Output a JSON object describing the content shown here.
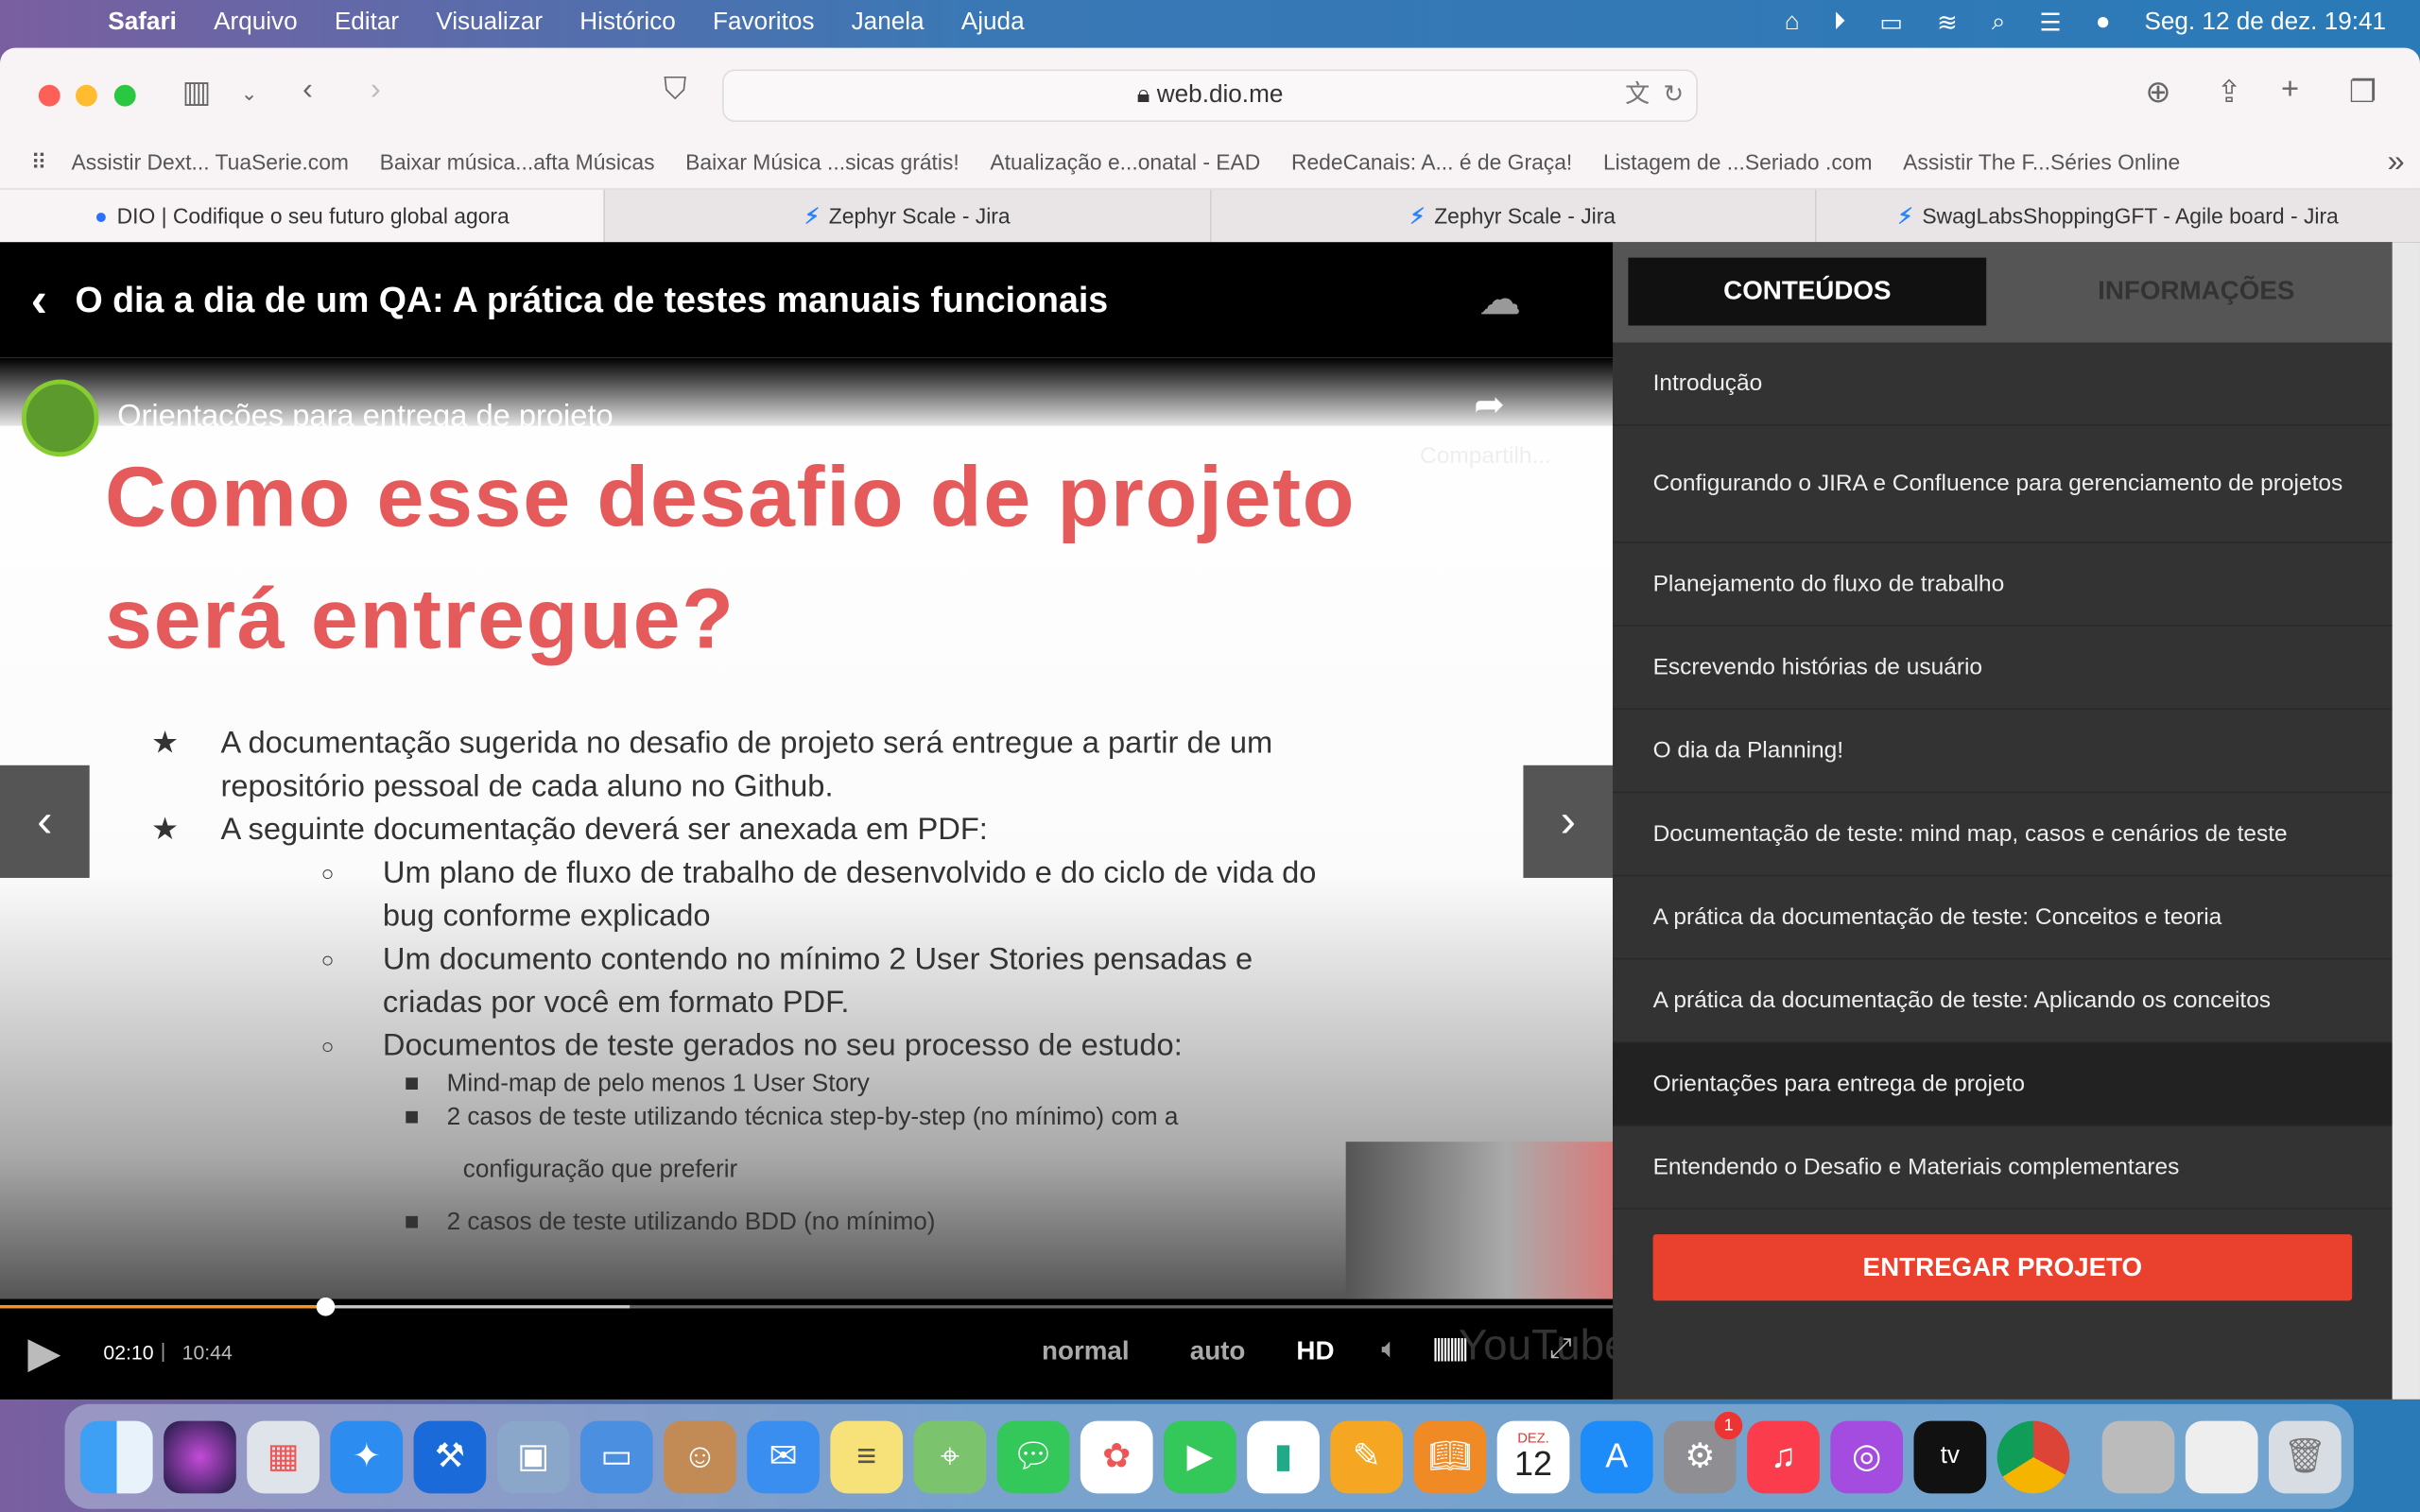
{
  "menubar": {
    "app": "Safari",
    "items": [
      "Arquivo",
      "Editar",
      "Visualizar",
      "Histórico",
      "Favoritos",
      "Janela",
      "Ajuda"
    ],
    "datetime": "Seg. 12 de dez.  19:41"
  },
  "browser": {
    "url": "web.dio.me",
    "bookmarks": [
      "Assistir Dext... TuaSerie.com",
      "Baixar música...afta Músicas",
      "Baixar Música ...sicas grátis!",
      "Atualização e...onatal - EAD",
      "RedeCanais: A... é de Graça!",
      "Listagem de ...Seriado .com",
      "Assistir The F...Séries Online"
    ],
    "tabs": [
      "DIO | Codifique o seu futuro global agora",
      "Zephyr Scale - Jira",
      "Zephyr Scale - Jira",
      "SwagLabsShoppingGFT - Agile board - Jira"
    ]
  },
  "course": {
    "title": "O dia a dia de um QA: A prática de testes manuais funcionais"
  },
  "video": {
    "yt_title": "Orientações para entrega de projeto",
    "share": "Compartilh...",
    "slide": {
      "heading1": "Como esse desafio de projeto",
      "heading2": "será entregue?",
      "b1a": "A documentação sugerida no desafio de projeto será entregue a partir de um",
      "b1b": "repositório pessoal de cada aluno no Github.",
      "b2": "A seguinte documentação deverá ser anexada em PDF:",
      "s1a": "Um plano de fluxo de trabalho de desenvolvido e do ciclo de vida do",
      "s1b": "bug conforme explicado",
      "s2a": "Um documento contendo no mínimo 2 User Stories pensadas e",
      "s2b": "criadas por você em formato PDF.",
      "s3": "Documentos de teste gerados no seu processo de estudo:",
      "t1": "Mind-map de pelo menos 1 User Story",
      "t2a": "2 casos de teste utilizando técnica step-by-step (no mínimo) com a",
      "t2b": "configuração que preferir",
      "t3": "2 casos de teste utilizando BDD (no mínimo)"
    },
    "current_time": "02:10",
    "duration": "10:44",
    "progress": 0.202,
    "buffered": 0.39,
    "speed": "normal",
    "quality_auto": "auto",
    "quality_hd": "HD",
    "youtube": "YouTube"
  },
  "sidebar": {
    "tabs": [
      "CONTEÚDOS",
      "INFORMAÇÕES"
    ],
    "items": [
      "Introdução",
      "Configurando o JIRA e Confluence para gerenciamento de projetos",
      "Planejamento do fluxo de trabalho",
      "Escrevendo histórias de usuário",
      "O dia da Planning!",
      "Documentação de teste: mind map, casos e cenários de teste",
      "A prática da documentação de teste: Conceitos e teoria",
      "A prática da documentação de teste: Aplicando os conceitos",
      "Orientações para entrega de projeto",
      "Entendendo o Desafio e Materiais complementares"
    ],
    "active_index": 8,
    "deliver": "ENTREGAR PROJETO"
  },
  "dock": {
    "calendar_month": "DEZ.",
    "calendar_day": "12",
    "settings_badge": "1",
    "tv": "tv"
  },
  "colors": {
    "accent": "#e9412d",
    "slide_heading": "#e55a5a",
    "progress": "#f7941d"
  }
}
